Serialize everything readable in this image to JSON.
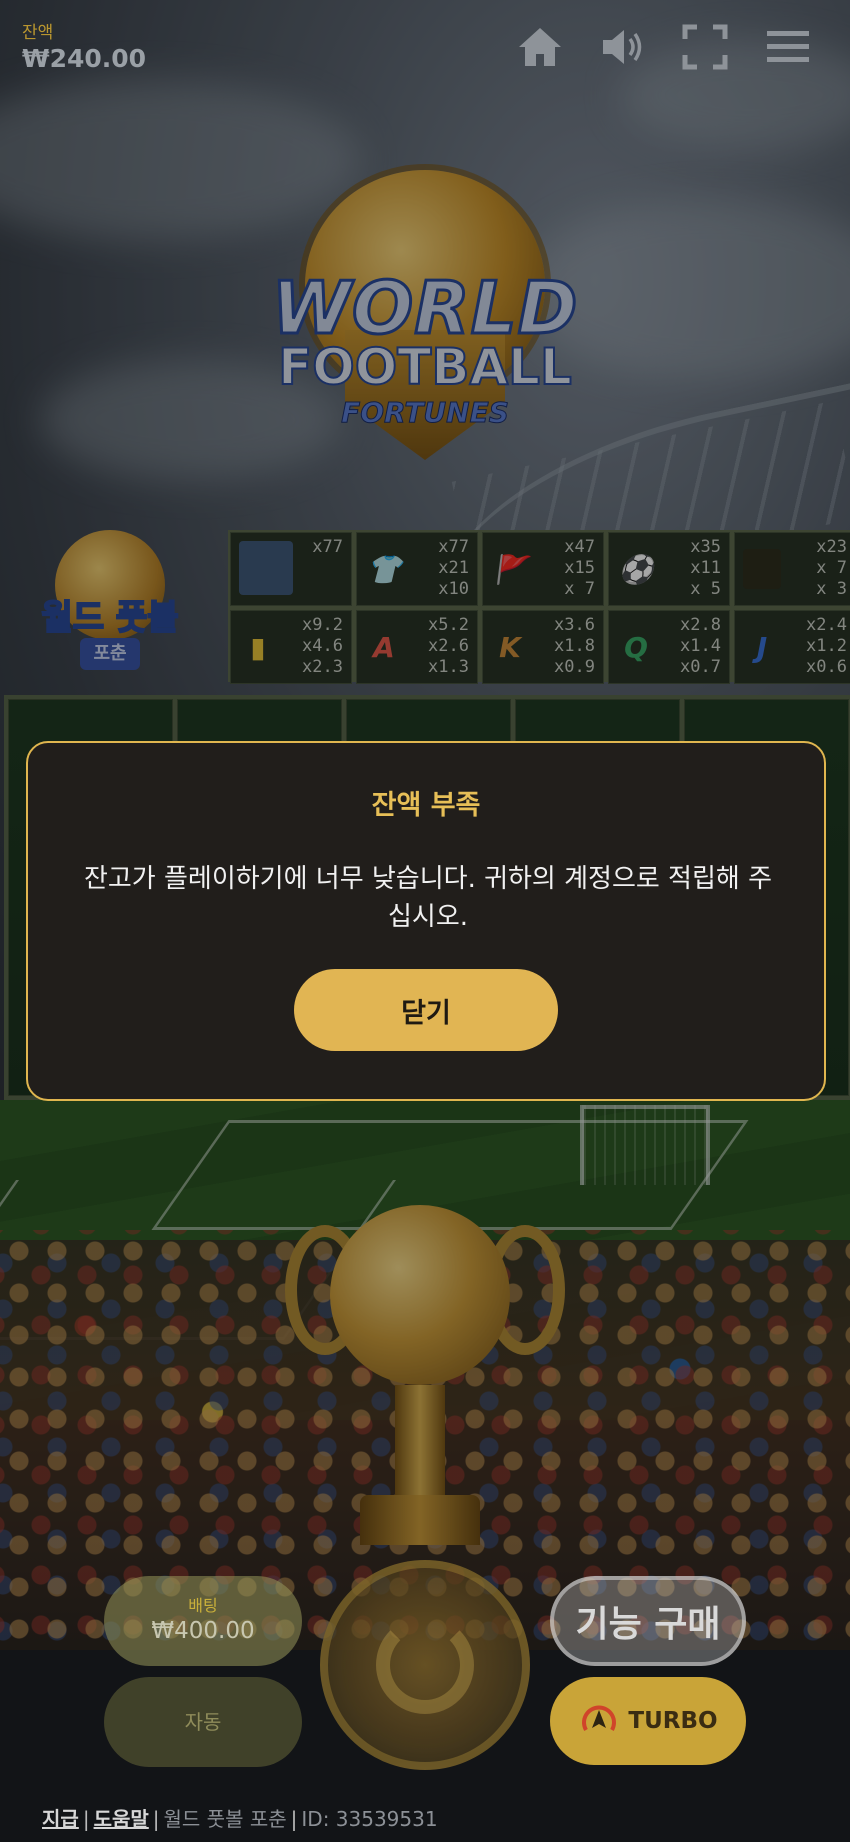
{
  "balance": {
    "label": "잔액",
    "value": "₩240.00"
  },
  "top_icons": [
    "home-icon",
    "volume-icon",
    "fullscreen-icon",
    "menu-icon"
  ],
  "logo": {
    "line1": "WORLD",
    "line2": "FOOTBALL",
    "line3": "FORTUNES",
    "small_title": "월드 풋볼",
    "small_sub": "포춘"
  },
  "paytable": [
    {
      "symbol": "player-icon",
      "glyph": "",
      "vals": "x77"
    },
    {
      "symbol": "jersey-icon",
      "glyph": "👕",
      "vals": "x77\nx21\nx10"
    },
    {
      "symbol": "whistle-flag-icon",
      "glyph": "🚩",
      "vals": "x47\nx15\nx 7"
    },
    {
      "symbol": "ball-icon",
      "glyph": "⚽",
      "vals": "x35\nx11\nx 5"
    },
    {
      "symbol": "boots-icon",
      "glyph": "",
      "vals": "x23\nx 7\nx 3"
    },
    {
      "symbol": "yellow-card-icon",
      "glyph": "▮",
      "vals": "x9.2\nx4.6\nx2.3"
    },
    {
      "symbol": "letter-a-icon",
      "glyph": "A",
      "vals": "x5.2\nx2.6\nx1.3"
    },
    {
      "symbol": "letter-k-icon",
      "glyph": "K",
      "vals": "x3.6\nx1.8\nx0.9"
    },
    {
      "symbol": "letter-q-icon",
      "glyph": "Q",
      "vals": "x2.8\nx1.4\nx0.7"
    },
    {
      "symbol": "letter-j-icon",
      "glyph": "J",
      "vals": "x2.4\nx1.2\nx0.6"
    }
  ],
  "modal": {
    "title": "잔액 부족",
    "message": "잔고가 플레이하기에 너무 낮습니다. 귀하의 계정으로 적립해 주십시오.",
    "close_label": "닫기"
  },
  "controls": {
    "bet_label": "배팅",
    "bet_value": "₩400.00",
    "auto_label": "자동",
    "feature_buy_label": "기능 구매",
    "turbo_label": "TURBO"
  },
  "footer": {
    "pay_link": "지급",
    "help_link": "도움말",
    "game_name": "월드 풋볼 포춘",
    "id_text": "ID: 33539531"
  },
  "colors": {
    "accent": "#e1b553",
    "modal_bg": "#211e1b",
    "title_gold": "#e7bf57"
  }
}
